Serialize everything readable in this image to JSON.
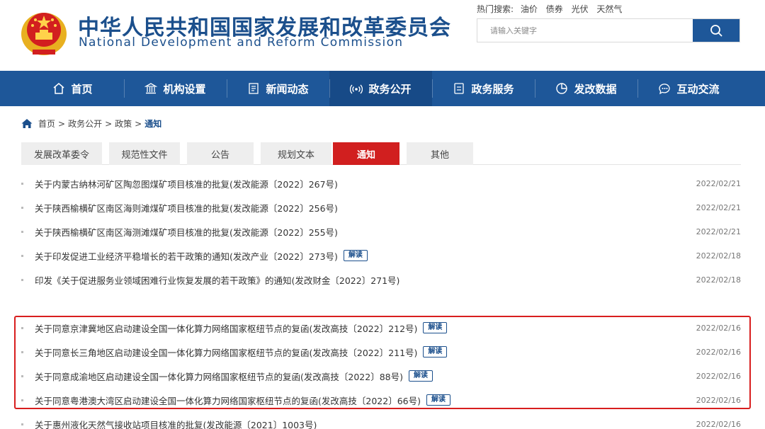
{
  "header": {
    "title_cn": "中华人民共和国国家发展和改革委员会",
    "title_en": "National Development and Reform Commission",
    "hot_label": "热门搜索:",
    "hot_terms": [
      "油价",
      "债券",
      "光伏",
      "天然气"
    ],
    "search_placeholder": "请输入关键字"
  },
  "icons": {
    "emblem": "national-emblem",
    "search": "search-icon",
    "home": "home-icon"
  },
  "nav": {
    "items": [
      {
        "label": "首页",
        "icon": "home-icon"
      },
      {
        "label": "机构设置",
        "icon": "building-icon"
      },
      {
        "label": "新闻动态",
        "icon": "news-icon"
      },
      {
        "label": "政务公开",
        "icon": "broadcast-icon"
      },
      {
        "label": "政务服务",
        "icon": "service-icon"
      },
      {
        "label": "发改数据",
        "icon": "pie-chart-icon"
      },
      {
        "label": "互动交流",
        "icon": "chat-icon"
      }
    ],
    "active_index": 3
  },
  "breadcrumb": {
    "items": [
      "首页",
      "政务公开",
      "政策"
    ],
    "separator": ">",
    "current": "通知"
  },
  "tabs": {
    "items": [
      "发展改革委令",
      "规范性文件",
      "公告",
      "规划文本",
      "通知",
      "其他"
    ],
    "active_index": 4
  },
  "list": {
    "badge_label": "解读",
    "items": [
      {
        "title": "关于内蒙古纳林河矿区陶忽图煤矿项目核准的批复(发改能源〔2022〕267号)",
        "date": "2022/02/21",
        "badge": false
      },
      {
        "title": "关于陕西榆横矿区南区海则滩煤矿项目核准的批复(发改能源〔2022〕256号)",
        "date": "2022/02/21",
        "badge": false
      },
      {
        "title": "关于陕西榆横矿区南区海测滩煤矿项目核准的批复(发改能源〔2022〕255号)",
        "date": "2022/02/21",
        "badge": false
      },
      {
        "title": "关于印发促进工业经济平稳增长的若干政策的通知(发改产业〔2022〕273号)",
        "date": "2022/02/18",
        "badge": true
      },
      {
        "title": "印发《关于促进服务业领域困难行业恢复发展的若干政策》的通知(发改财金〔2022〕271号)",
        "date": "2022/02/18",
        "badge": false
      },
      {
        "title": "关于同意京津冀地区启动建设全国一体化算力网络国家枢纽节点的复函(发改高技〔2022〕212号)",
        "date": "2022/02/16",
        "badge": true
      },
      {
        "title": "关于同意长三角地区启动建设全国一体化算力网络国家枢纽节点的复函(发改高技〔2022〕211号)",
        "date": "2022/02/16",
        "badge": true
      },
      {
        "title": "关于同意成渝地区启动建设全国一体化算力网络国家枢纽节点的复函(发改高技〔2022〕88号)",
        "date": "2022/02/16",
        "badge": true
      },
      {
        "title": "关于同意粤港澳大湾区启动建设全国一体化算力网络国家枢纽节点的复函(发改高技〔2022〕66号)",
        "date": "2022/02/16",
        "badge": true
      },
      {
        "title": "关于惠州液化天然气接收站项目核准的批复(发改能源〔2021〕1003号)",
        "date": "2022/02/16",
        "badge": false
      }
    ]
  },
  "colors": {
    "brand_blue": "#1e5799",
    "title_blue": "#1b4f8c",
    "active_red": "#d11f1f",
    "highlight_red": "#d81e1e"
  }
}
